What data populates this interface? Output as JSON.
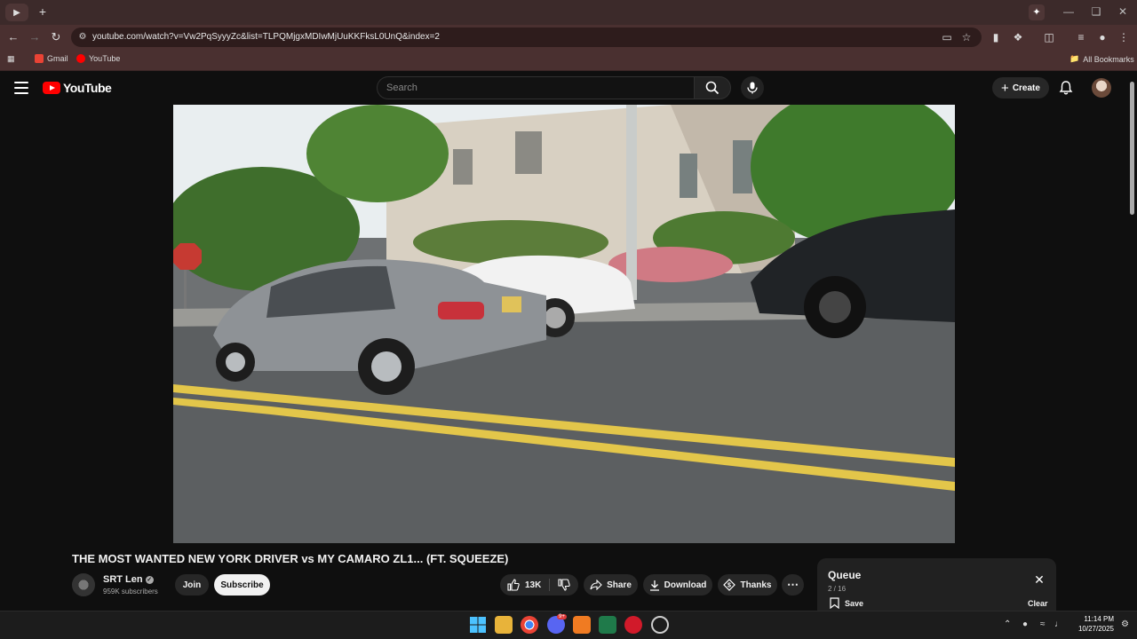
{
  "browser": {
    "tab_icon": "audio-playing-icon",
    "url": "youtube.com/watch?v=Vw2PqSyyyZc&list=TLPQMjgxMDIwMjUuKKFksL0UnQ&index=2",
    "bookmarks": [
      {
        "label": "Gmail",
        "icon": "gmail-icon"
      },
      {
        "label": "YouTube",
        "icon": "youtube-icon"
      }
    ],
    "all_bookmarks_label": "All Bookmarks"
  },
  "youtube": {
    "logo_text": "YouTube",
    "search_placeholder": "Search",
    "create_label": "Create"
  },
  "video": {
    "title": "THE MOST WANTED NEW YORK DRIVER vs MY CAMARO ZL1... (FT. SQUEEZE)",
    "channel_name": "SRT Len",
    "subscribers": "959K subscribers",
    "join_label": "Join",
    "subscribe_label": "Subscribe",
    "likes": "13K",
    "share_label": "Share",
    "download_label": "Download",
    "thanks_label": "Thanks"
  },
  "queue": {
    "title": "Queue",
    "count": "2 / 16",
    "save_label": "Save",
    "clear_label": "Clear"
  },
  "taskbar": {
    "time": "11:14 PM",
    "date": "10/27/2025",
    "discord_badge": "9+"
  },
  "colors": {
    "youtube_red": "#ff0000",
    "browser_frame": "#3c2a2a",
    "page_bg": "#0f0f0f"
  }
}
